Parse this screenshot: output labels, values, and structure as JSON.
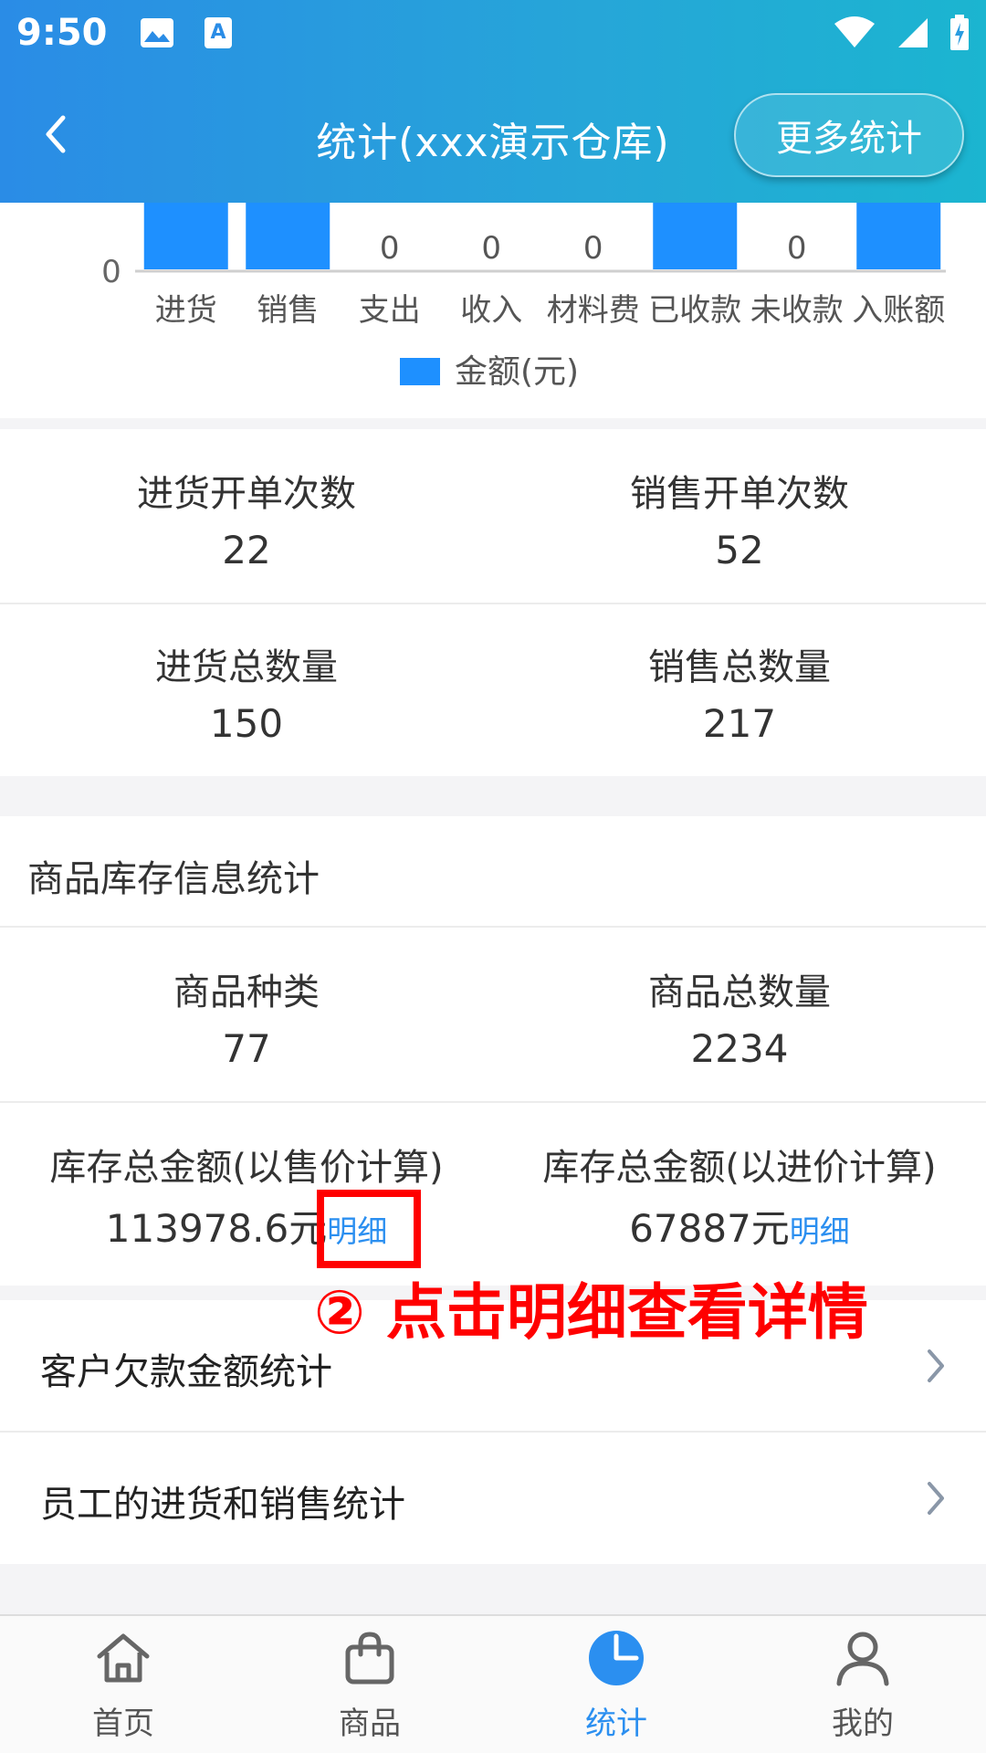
{
  "status_bar": {
    "time": "9:50"
  },
  "header": {
    "title": "统计(xxx演示仓库)",
    "more_button": "更多统计"
  },
  "chart_data": {
    "type": "bar",
    "categories": [
      "进货",
      "销售",
      "支出",
      "收入",
      "材料费",
      "已收款",
      "未收款",
      "入账额"
    ],
    "series": [
      {
        "name": "金额(元)",
        "values": [
          null,
          null,
          0,
          0,
          0,
          null,
          0,
          null
        ],
        "color": "#1e90ff"
      }
    ],
    "data_labels": [
      "",
      "",
      "0",
      "0",
      "0",
      "",
      "0",
      ""
    ],
    "y_tick_visible": "0",
    "legend_position": "bottom-center",
    "legend_label": "金额(元)"
  },
  "order_stats": {
    "purchase_count_label": "进货开单次数",
    "purchase_count": "22",
    "sales_count_label": "销售开单次数",
    "sales_count": "52",
    "purchase_qty_label": "进货总数量",
    "purchase_qty": "150",
    "sales_qty_label": "销售总数量",
    "sales_qty": "217"
  },
  "inventory": {
    "section_title": "商品库存信息统计",
    "kinds_label": "商品种类",
    "kinds": "77",
    "total_qty_label": "商品总数量",
    "total_qty": "2234",
    "amount_sale_label": "库存总金额(以售价计算)",
    "amount_sale": "113978.6元",
    "amount_cost_label": "库存总金额(以进价计算)",
    "amount_cost": "67887元",
    "detail_link": "明细"
  },
  "annotation": "② 点击明细查看详情",
  "menu": [
    {
      "label": "客户欠款金额统计"
    },
    {
      "label": "员工的进货和销售统计"
    }
  ],
  "bottom_nav": [
    {
      "label": "首页",
      "icon": "home-icon"
    },
    {
      "label": "商品",
      "icon": "bag-icon"
    },
    {
      "label": "统计",
      "icon": "pie-chart-icon",
      "active": true
    },
    {
      "label": "我的",
      "icon": "user-icon"
    }
  ],
  "colors": {
    "accent": "#2b8ff0",
    "bar": "#1e90ff",
    "annotation": "#ff0000"
  }
}
